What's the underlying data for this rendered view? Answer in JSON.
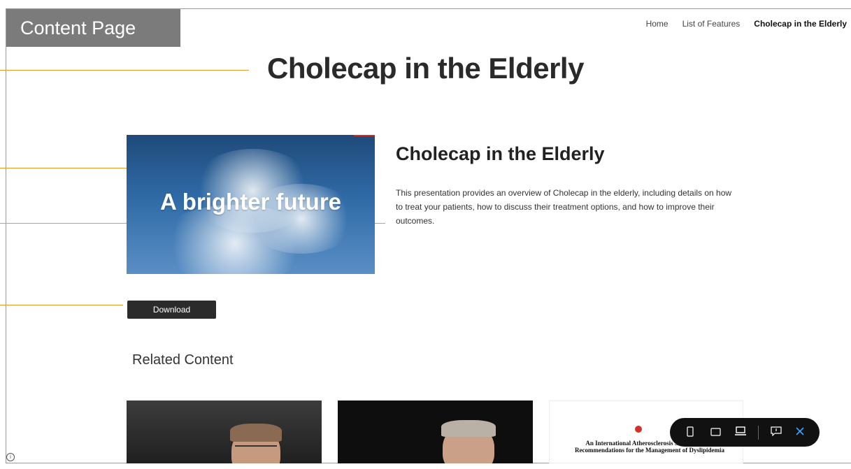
{
  "content_tag": "Content Page",
  "nav": {
    "home": "Home",
    "features": "List of Features",
    "current": "Cholecap in the Elderly"
  },
  "page_title": "Cholecap in the Elderly",
  "hero": {
    "text": "A brighter future"
  },
  "article": {
    "title": "Cholecap in the Elderly",
    "description": "This presentation provides an overview of Cholecap in the elderly, including details on how to treat your patients, how to discuss their treatment options, and how to improve their outcomes."
  },
  "download_label": "Download",
  "related": {
    "heading": "Related Content",
    "card3_text": "An International Atherosclerosis Society Global Recommendations for the Management of Dyslipidemia"
  },
  "toolbar": {
    "icons": [
      "phone-icon",
      "tablet-icon",
      "laptop-icon",
      "feedback-icon",
      "close-icon"
    ]
  },
  "colors": {
    "callout": "#e89a2a",
    "tag_bg": "#7b7b7b",
    "button_bg": "#2b2b2b",
    "close_accent": "#3ba6ff"
  }
}
